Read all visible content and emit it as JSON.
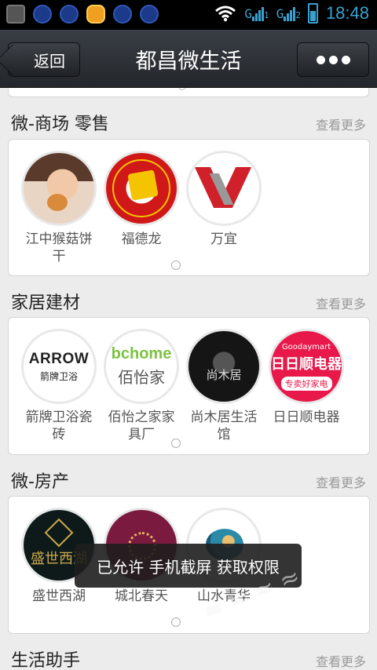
{
  "status_bar": {
    "time": "18:48",
    "sim1_label": "1",
    "sim2_label": "2",
    "notification_icons": [
      "shield-icon",
      "baidu-icon",
      "baidu-icon",
      "qq-icon",
      "baidu-icon",
      "baidu-icon"
    ]
  },
  "title_bar": {
    "back_label": "返回",
    "title": "都昌微生活"
  },
  "sections": [
    {
      "title": "微-商场 零售",
      "see_more": "查看更多",
      "items": [
        {
          "label_line1": "江中猴菇饼",
          "label_line2": "干"
        },
        {
          "label_line1": "福德龙",
          "label_line2": ""
        },
        {
          "label_line1": "万宜",
          "label_line2": ""
        }
      ]
    },
    {
      "title": "家居建材",
      "see_more": "查看更多",
      "items": [
        {
          "label_line1": "箭牌卫浴瓷",
          "label_line2": "砖",
          "logo_text1": "ARROW",
          "logo_text2": "箭牌卫浴"
        },
        {
          "label_line1": "佰怡之家家",
          "label_line2": "具厂",
          "logo_text1": "bchome",
          "logo_text2": "佰怡家"
        },
        {
          "label_line1": "尚木居生活",
          "label_line2": "馆",
          "logo_text1": "尚木居"
        },
        {
          "label_line1": "日日顺电器",
          "label_line2": "",
          "logo_text0": "Goodaymart",
          "logo_text1": "日日顺电器",
          "logo_text2": "专卖好家电"
        }
      ]
    },
    {
      "title": "微-房产",
      "see_more": "查看更多",
      "items": [
        {
          "label_line1": "盛世西湖",
          "label_line2": "",
          "logo_text1": "盛世西湖"
        },
        {
          "label_line1": "城北春天",
          "label_line2": ""
        },
        {
          "label_line1": "山水青华",
          "label_line2": ""
        }
      ]
    },
    {
      "title": "生活助手",
      "see_more": "查看更多"
    }
  ],
  "toast": "已允许 手机截屏 获取权限"
}
